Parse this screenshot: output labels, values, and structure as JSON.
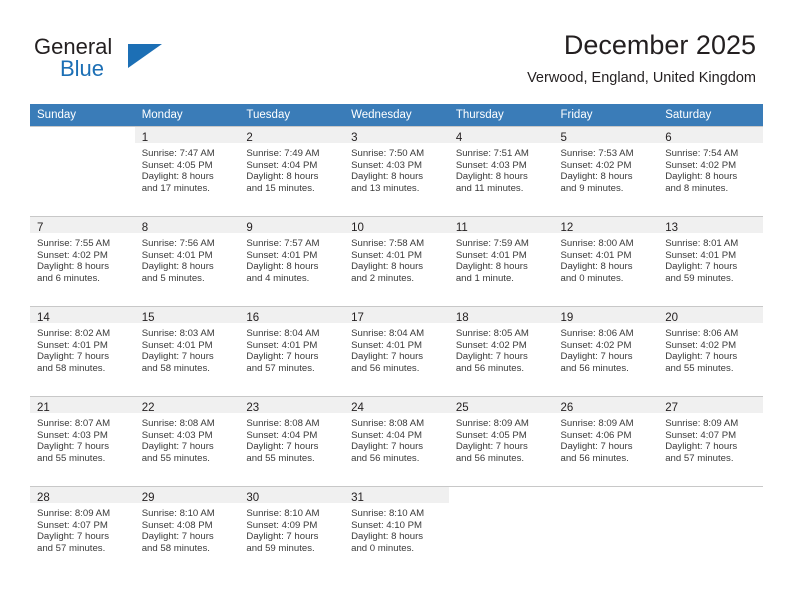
{
  "brand": {
    "word1": "General",
    "word2": "Blue",
    "flag_icon": "flag-triangle-icon",
    "accent_color": "#1c6fb5"
  },
  "header": {
    "title": "December 2025",
    "subtitle": "Verwood, England, United Kingdom"
  },
  "calendar": {
    "header_bg": "#3a7cb8",
    "header_text_color": "#ffffff",
    "daynum_band_bg": "#f0f0f0",
    "weekdays": [
      "Sunday",
      "Monday",
      "Tuesday",
      "Wednesday",
      "Thursday",
      "Friday",
      "Saturday"
    ],
    "weeks": [
      [
        {
          "day": "",
          "sunrise": "",
          "sunset": "",
          "daylight_1": "",
          "daylight_2": ""
        },
        {
          "day": "1",
          "sunrise": "Sunrise: 7:47 AM",
          "sunset": "Sunset: 4:05 PM",
          "daylight_1": "Daylight: 8 hours",
          "daylight_2": "and 17 minutes."
        },
        {
          "day": "2",
          "sunrise": "Sunrise: 7:49 AM",
          "sunset": "Sunset: 4:04 PM",
          "daylight_1": "Daylight: 8 hours",
          "daylight_2": "and 15 minutes."
        },
        {
          "day": "3",
          "sunrise": "Sunrise: 7:50 AM",
          "sunset": "Sunset: 4:03 PM",
          "daylight_1": "Daylight: 8 hours",
          "daylight_2": "and 13 minutes."
        },
        {
          "day": "4",
          "sunrise": "Sunrise: 7:51 AM",
          "sunset": "Sunset: 4:03 PM",
          "daylight_1": "Daylight: 8 hours",
          "daylight_2": "and 11 minutes."
        },
        {
          "day": "5",
          "sunrise": "Sunrise: 7:53 AM",
          "sunset": "Sunset: 4:02 PM",
          "daylight_1": "Daylight: 8 hours",
          "daylight_2": "and 9 minutes."
        },
        {
          "day": "6",
          "sunrise": "Sunrise: 7:54 AM",
          "sunset": "Sunset: 4:02 PM",
          "daylight_1": "Daylight: 8 hours",
          "daylight_2": "and 8 minutes."
        }
      ],
      [
        {
          "day": "7",
          "sunrise": "Sunrise: 7:55 AM",
          "sunset": "Sunset: 4:02 PM",
          "daylight_1": "Daylight: 8 hours",
          "daylight_2": "and 6 minutes."
        },
        {
          "day": "8",
          "sunrise": "Sunrise: 7:56 AM",
          "sunset": "Sunset: 4:01 PM",
          "daylight_1": "Daylight: 8 hours",
          "daylight_2": "and 5 minutes."
        },
        {
          "day": "9",
          "sunrise": "Sunrise: 7:57 AM",
          "sunset": "Sunset: 4:01 PM",
          "daylight_1": "Daylight: 8 hours",
          "daylight_2": "and 4 minutes."
        },
        {
          "day": "10",
          "sunrise": "Sunrise: 7:58 AM",
          "sunset": "Sunset: 4:01 PM",
          "daylight_1": "Daylight: 8 hours",
          "daylight_2": "and 2 minutes."
        },
        {
          "day": "11",
          "sunrise": "Sunrise: 7:59 AM",
          "sunset": "Sunset: 4:01 PM",
          "daylight_1": "Daylight: 8 hours",
          "daylight_2": "and 1 minute."
        },
        {
          "day": "12",
          "sunrise": "Sunrise: 8:00 AM",
          "sunset": "Sunset: 4:01 PM",
          "daylight_1": "Daylight: 8 hours",
          "daylight_2": "and 0 minutes."
        },
        {
          "day": "13",
          "sunrise": "Sunrise: 8:01 AM",
          "sunset": "Sunset: 4:01 PM",
          "daylight_1": "Daylight: 7 hours",
          "daylight_2": "and 59 minutes."
        }
      ],
      [
        {
          "day": "14",
          "sunrise": "Sunrise: 8:02 AM",
          "sunset": "Sunset: 4:01 PM",
          "daylight_1": "Daylight: 7 hours",
          "daylight_2": "and 58 minutes."
        },
        {
          "day": "15",
          "sunrise": "Sunrise: 8:03 AM",
          "sunset": "Sunset: 4:01 PM",
          "daylight_1": "Daylight: 7 hours",
          "daylight_2": "and 58 minutes."
        },
        {
          "day": "16",
          "sunrise": "Sunrise: 8:04 AM",
          "sunset": "Sunset: 4:01 PM",
          "daylight_1": "Daylight: 7 hours",
          "daylight_2": "and 57 minutes."
        },
        {
          "day": "17",
          "sunrise": "Sunrise: 8:04 AM",
          "sunset": "Sunset: 4:01 PM",
          "daylight_1": "Daylight: 7 hours",
          "daylight_2": "and 56 minutes."
        },
        {
          "day": "18",
          "sunrise": "Sunrise: 8:05 AM",
          "sunset": "Sunset: 4:02 PM",
          "daylight_1": "Daylight: 7 hours",
          "daylight_2": "and 56 minutes."
        },
        {
          "day": "19",
          "sunrise": "Sunrise: 8:06 AM",
          "sunset": "Sunset: 4:02 PM",
          "daylight_1": "Daylight: 7 hours",
          "daylight_2": "and 56 minutes."
        },
        {
          "day": "20",
          "sunrise": "Sunrise: 8:06 AM",
          "sunset": "Sunset: 4:02 PM",
          "daylight_1": "Daylight: 7 hours",
          "daylight_2": "and 55 minutes."
        }
      ],
      [
        {
          "day": "21",
          "sunrise": "Sunrise: 8:07 AM",
          "sunset": "Sunset: 4:03 PM",
          "daylight_1": "Daylight: 7 hours",
          "daylight_2": "and 55 minutes."
        },
        {
          "day": "22",
          "sunrise": "Sunrise: 8:08 AM",
          "sunset": "Sunset: 4:03 PM",
          "daylight_1": "Daylight: 7 hours",
          "daylight_2": "and 55 minutes."
        },
        {
          "day": "23",
          "sunrise": "Sunrise: 8:08 AM",
          "sunset": "Sunset: 4:04 PM",
          "daylight_1": "Daylight: 7 hours",
          "daylight_2": "and 55 minutes."
        },
        {
          "day": "24",
          "sunrise": "Sunrise: 8:08 AM",
          "sunset": "Sunset: 4:04 PM",
          "daylight_1": "Daylight: 7 hours",
          "daylight_2": "and 56 minutes."
        },
        {
          "day": "25",
          "sunrise": "Sunrise: 8:09 AM",
          "sunset": "Sunset: 4:05 PM",
          "daylight_1": "Daylight: 7 hours",
          "daylight_2": "and 56 minutes."
        },
        {
          "day": "26",
          "sunrise": "Sunrise: 8:09 AM",
          "sunset": "Sunset: 4:06 PM",
          "daylight_1": "Daylight: 7 hours",
          "daylight_2": "and 56 minutes."
        },
        {
          "day": "27",
          "sunrise": "Sunrise: 8:09 AM",
          "sunset": "Sunset: 4:07 PM",
          "daylight_1": "Daylight: 7 hours",
          "daylight_2": "and 57 minutes."
        }
      ],
      [
        {
          "day": "28",
          "sunrise": "Sunrise: 8:09 AM",
          "sunset": "Sunset: 4:07 PM",
          "daylight_1": "Daylight: 7 hours",
          "daylight_2": "and 57 minutes."
        },
        {
          "day": "29",
          "sunrise": "Sunrise: 8:10 AM",
          "sunset": "Sunset: 4:08 PM",
          "daylight_1": "Daylight: 7 hours",
          "daylight_2": "and 58 minutes."
        },
        {
          "day": "30",
          "sunrise": "Sunrise: 8:10 AM",
          "sunset": "Sunset: 4:09 PM",
          "daylight_1": "Daylight: 7 hours",
          "daylight_2": "and 59 minutes."
        },
        {
          "day": "31",
          "sunrise": "Sunrise: 8:10 AM",
          "sunset": "Sunset: 4:10 PM",
          "daylight_1": "Daylight: 8 hours",
          "daylight_2": "and 0 minutes."
        },
        {
          "day": "",
          "sunrise": "",
          "sunset": "",
          "daylight_1": "",
          "daylight_2": ""
        },
        {
          "day": "",
          "sunrise": "",
          "sunset": "",
          "daylight_1": "",
          "daylight_2": ""
        },
        {
          "day": "",
          "sunrise": "",
          "sunset": "",
          "daylight_1": "",
          "daylight_2": ""
        }
      ]
    ]
  }
}
